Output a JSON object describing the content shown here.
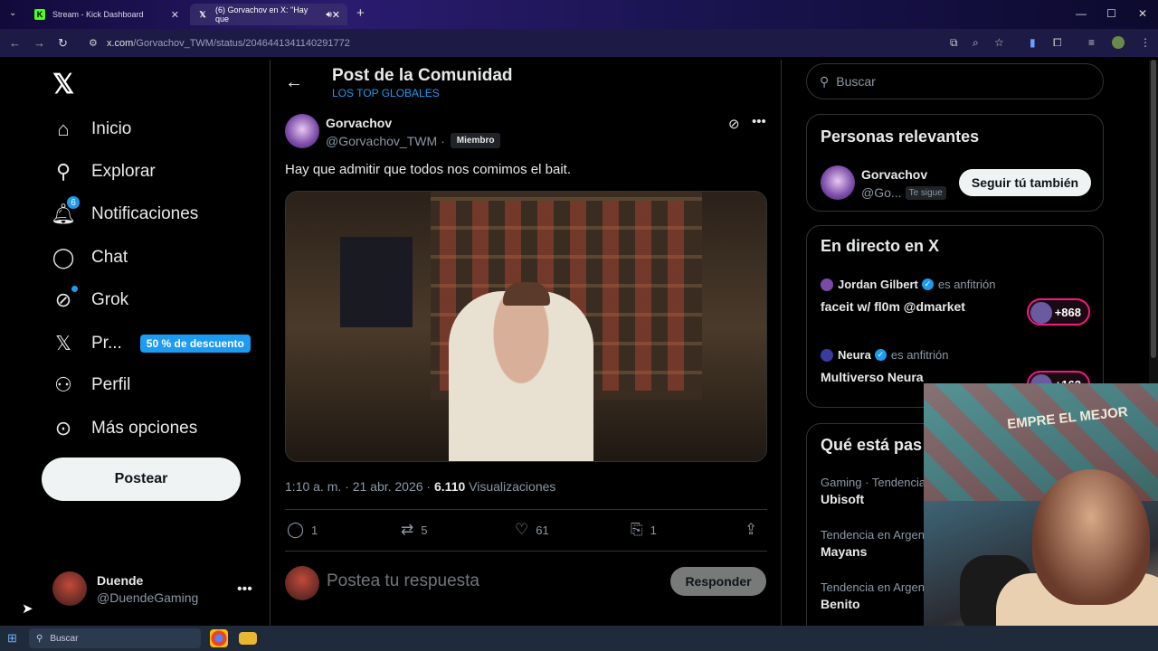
{
  "browser": {
    "tabs": [
      {
        "title": "Stream - Kick Dashboard",
        "icon": "kick-icon"
      },
      {
        "title": "(6) Gorvachov en X: \"Hay que",
        "icon": "x-icon"
      }
    ],
    "new_tab": "+",
    "url_domain": "x.com",
    "url_path": "/Gorvachov_TWM/status/2046441341140291772"
  },
  "nav": {
    "logo": "𝕏",
    "items": [
      {
        "label": "Inicio",
        "icon": "home-icon"
      },
      {
        "label": "Explorar",
        "icon": "search-icon"
      },
      {
        "label": "Notificaciones",
        "icon": "bell-icon",
        "badge": "6"
      },
      {
        "label": "Chat",
        "icon": "chat-icon"
      },
      {
        "label": "Grok",
        "icon": "grok-icon"
      },
      {
        "label": "Pr...",
        "icon": "x-premium-icon",
        "promo": "50 % de descuento"
      },
      {
        "label": "Perfil",
        "icon": "person-icon"
      },
      {
        "label": "Más opciones",
        "icon": "more-options-icon"
      }
    ],
    "post_button": "Postear",
    "account": {
      "name": "Duende",
      "handle": "@DuendeGaming"
    }
  },
  "post": {
    "header_title": "Post de la Comunidad",
    "header_subtitle": "LOS TOP GLOBALES",
    "author_name": "Gorvachov",
    "author_handle": "@Gorvachov_TWM",
    "handle_separator": "·",
    "member_badge": "Miembro",
    "text": "Hay que admitir que todos nos comimos el bait.",
    "time": "1:10 a. m. · 21 abr. 2026 ·",
    "views_count": "6.110",
    "views_label": "Visualizaciones",
    "replies": "1",
    "reposts": "5",
    "likes": "61",
    "bookmarks": "1",
    "reply_placeholder": "Postea tu respuesta",
    "reply_button": "Responder"
  },
  "sidebar": {
    "search_placeholder": "Buscar",
    "relevant_title": "Personas relevantes",
    "relevant_person": {
      "name": "Gorvachov",
      "handle": "@Go...",
      "follows_you": "Te sigue",
      "follow_button": "Seguir tú también"
    },
    "live_title": "En directo en X",
    "live": [
      {
        "host": "Jordan Gilbert",
        "role": "es anfitrión",
        "title": "faceit w/ fl0m @dmarket",
        "count": "+868"
      },
      {
        "host": "Neura",
        "role": "es anfitrión",
        "title": "Multiverso Neura",
        "count": "+162"
      }
    ],
    "trending_title": "Qué está pas",
    "trends": [
      {
        "meta": "Gaming · Tendencia",
        "name": "Ubisoft"
      },
      {
        "meta": "Tendencia en Argent",
        "name": "Mayans"
      },
      {
        "meta": "Tendencia en Argent",
        "name": "Benito"
      }
    ]
  },
  "webcam": {
    "wall_text": "EMPRE EL MEJOR"
  },
  "taskbar": {
    "search": "Buscar"
  },
  "colors": {
    "accent": "#1d9bf0",
    "live": "#f91880",
    "background": "#000000"
  }
}
